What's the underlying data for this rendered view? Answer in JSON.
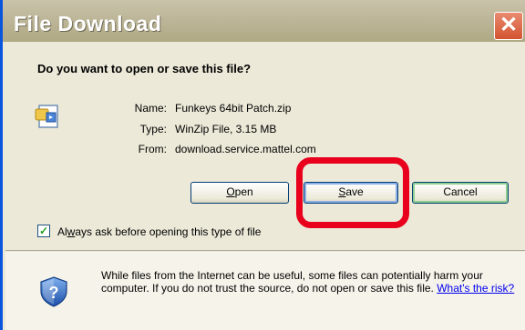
{
  "window": {
    "title": "File Download",
    "close_glyph": "✕"
  },
  "dialog": {
    "question": "Do you want to open or save this file?",
    "file_info": {
      "name_label": "Name:",
      "name_value": "Funkeys 64bit Patch.zip",
      "type_label": "Type:",
      "type_value": "WinZip File, 3.15 MB",
      "from_label": "From:",
      "from_value": "download.service.mattel.com"
    },
    "buttons": {
      "open": {
        "label": "Open",
        "hotkey": "O",
        "rest": "pen"
      },
      "save": {
        "label": "Save",
        "hotkey": "S",
        "rest": "ave"
      },
      "cancel": {
        "label": "Cancel"
      }
    },
    "always_ask": {
      "checked": true,
      "label_pre": "Al",
      "label_hotkey": "w",
      "label_post": "ays ask before opening this type of file"
    },
    "warning": {
      "text": "While files from the Internet can be useful, some files can potentially harm your computer. If you do not trust the source, do not open or save this file.",
      "link": "What's the risk?"
    }
  },
  "icons": {
    "file": "file-icon",
    "shield": "security-shield-icon",
    "close": "close-icon"
  },
  "colors": {
    "highlight": "#e8001c",
    "dialog_bg": "#ece9d8",
    "link": "#0000ee"
  }
}
